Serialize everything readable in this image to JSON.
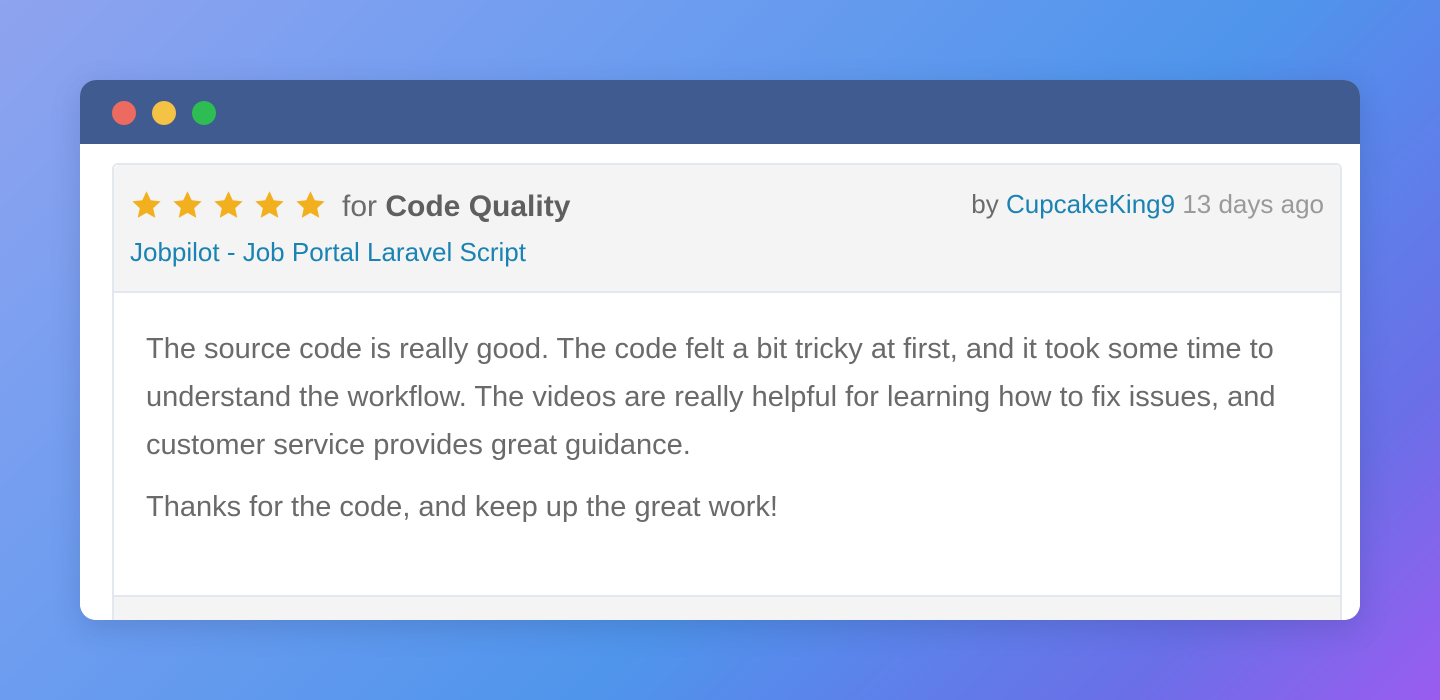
{
  "window": {
    "controls": [
      {
        "name": "close",
        "color": "#ec6a5f"
      },
      {
        "name": "minimize",
        "color": "#f4c244"
      },
      {
        "name": "maximize",
        "color": "#2ebd53"
      }
    ]
  },
  "review": {
    "rating": 5,
    "rating_max": 5,
    "star_icon": "star-icon",
    "star_color": "#f2b01e",
    "for_label": "for",
    "category": "Code Quality",
    "item_name": "Jobpilot - Job Portal Laravel Script",
    "by_label": "by",
    "author": "CupcakeKing9",
    "time_ago": "13 days ago",
    "body": [
      "The source code is really good. The code felt a bit tricky at first, and it took some time to understand the workflow. The videos are really helpful for learning how to fix issues, and customer service provides great guidance.",
      "Thanks for the code, and keep up the great work!"
    ]
  },
  "colors": {
    "link": "#1a83b3",
    "titlebar": "#3f5b8f",
    "text": "#6a6a6a"
  }
}
